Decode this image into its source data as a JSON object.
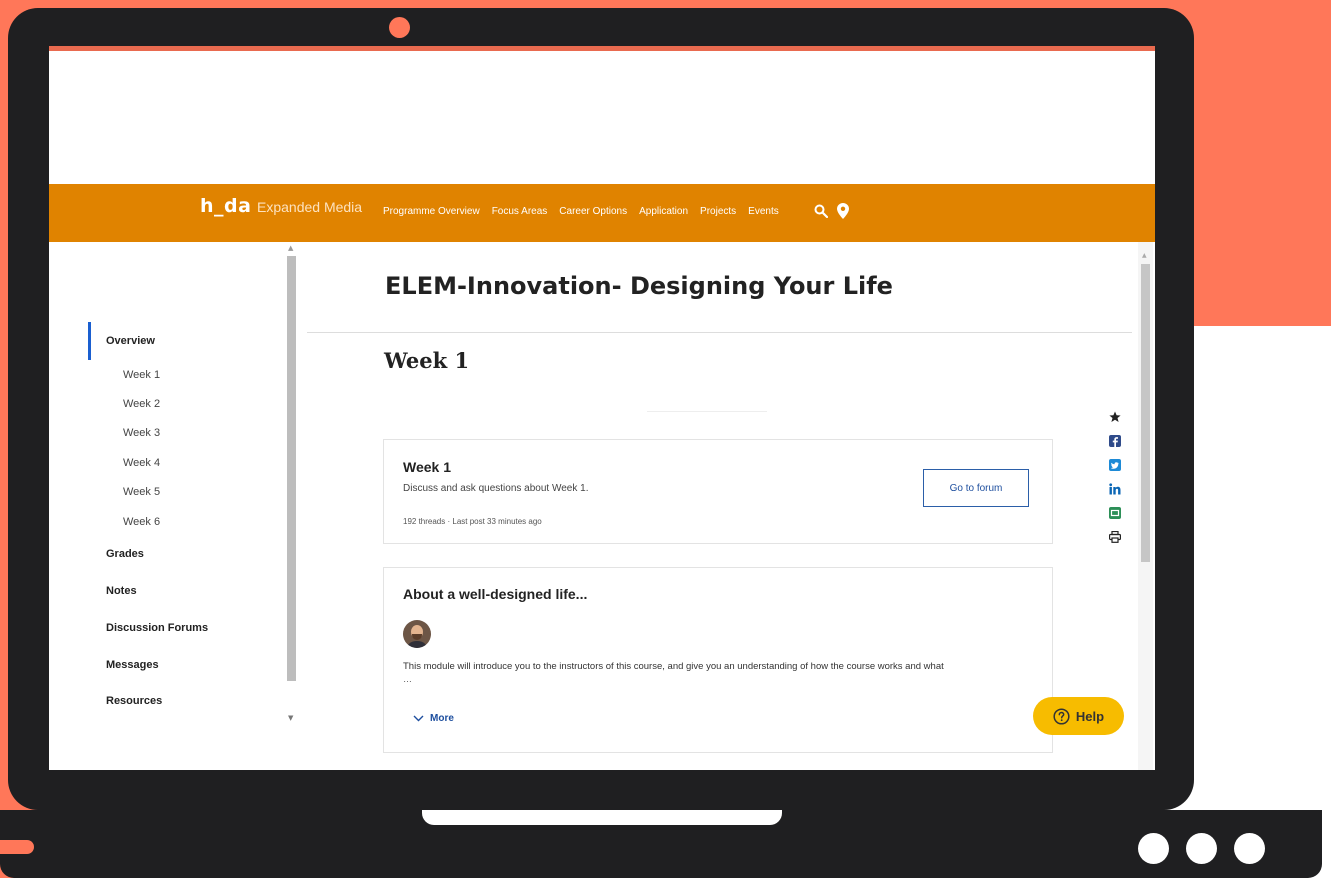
{
  "header": {
    "logo": "h_da",
    "site_name": "Expanded Media",
    "nav": [
      "Programme Overview",
      "Focus Areas",
      "Career Options",
      "Application",
      "Projects",
      "Events"
    ],
    "icons": [
      "search-icon",
      "location-pin-icon"
    ]
  },
  "sidebar": {
    "items": [
      {
        "label": "Overview",
        "level": "main",
        "active": true
      },
      {
        "label": "Week 1",
        "level": "sub"
      },
      {
        "label": "Week 2",
        "level": "sub"
      },
      {
        "label": "Week 3",
        "level": "sub"
      },
      {
        "label": "Week 4",
        "level": "sub"
      },
      {
        "label": "Week 5",
        "level": "sub"
      },
      {
        "label": "Week 6",
        "level": "sub"
      },
      {
        "label": "Grades",
        "level": "main"
      },
      {
        "label": "Notes",
        "level": "main"
      },
      {
        "label": "Discussion Forums",
        "level": "main"
      },
      {
        "label": "Messages",
        "level": "main"
      },
      {
        "label": "Resources",
        "level": "main"
      }
    ]
  },
  "main": {
    "course_title": "ELEM-Innovation- Designing Your Life",
    "week_heading": "Week 1",
    "forum_card": {
      "title": "Week 1",
      "description": "Discuss and ask questions about Week 1.",
      "meta": "192 threads · Last post 33 minutes ago",
      "button": "Go to forum"
    },
    "about_card": {
      "title": "About a well-designed life...",
      "text": "This module will introduce you to the instructors of this course, and give you an understanding of how the course works and what",
      "ellipsis": "…",
      "more": "More"
    }
  },
  "share_icons": [
    "star-icon",
    "facebook-icon",
    "twitter-icon",
    "linkedin-icon",
    "email-icon",
    "print-icon"
  ],
  "help": {
    "label": "Help"
  },
  "colors": {
    "nav": "#e08300",
    "accent": "#1a5fd0",
    "help": "#f7bc00",
    "background": "#ff7759"
  }
}
